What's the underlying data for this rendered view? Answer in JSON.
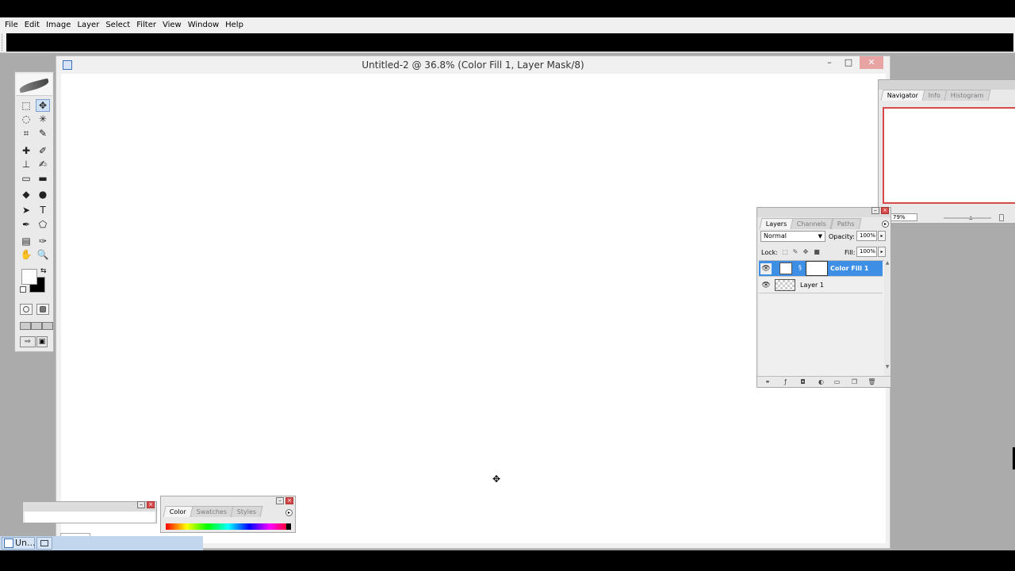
{
  "menubar": {
    "items": [
      "File",
      "Edit",
      "Image",
      "Layer",
      "Select",
      "Filter",
      "View",
      "Window",
      "Help"
    ]
  },
  "document": {
    "title": "Untitled-2 @ 36.8% (Color Fill 1, Layer Mask/8)",
    "min_label": "–",
    "max_label": "□",
    "close_label": "✕"
  },
  "toolbox": {
    "icons": [
      "marquee-icon",
      "move-icon",
      "lasso-icon",
      "magic-wand-icon",
      "crop-icon",
      "slice-icon",
      "healing-brush-icon",
      "brush-icon",
      "clone-stamp-icon",
      "history-brush-icon",
      "eraser-icon",
      "gradient-icon",
      "blur-icon",
      "dodge-icon",
      "path-selection-icon",
      "type-icon",
      "pen-icon",
      "shape-icon",
      "notes-icon",
      "eyedropper-icon",
      "hand-icon",
      "zoom-icon"
    ],
    "glyphs": [
      "⬚",
      "✥",
      "◌",
      "✳",
      "⌗",
      "✎",
      "✚",
      "✐",
      "⊥",
      "✍",
      "▭",
      "▬",
      "◆",
      "●",
      "➤",
      "T",
      "✒",
      "⬠",
      "▤",
      "✑",
      "✋",
      "🔍"
    ],
    "swap_glyph": "⇆"
  },
  "navigator": {
    "tabs": [
      "Navigator",
      "Info",
      "Histogram"
    ],
    "active_tab": "Navigator",
    "zoom": "79%",
    "view_box_color": "#d84a4a"
  },
  "layers": {
    "tabs": [
      "Layers",
      "Channels",
      "Paths"
    ],
    "active_tab": "Layers",
    "blend_mode": "Normal",
    "opacity_label": "Opacity:",
    "opacity": "100%",
    "lock_label": "Lock:",
    "fill_label": "Fill:",
    "fill": "100%",
    "items": [
      {
        "name": "Color Fill 1",
        "selected": true
      },
      {
        "name": "Layer 1",
        "selected": false
      }
    ],
    "selection_color": "#3d8fe6"
  },
  "color_palette": {
    "tabs": [
      "Color",
      "Swatches",
      "Styles"
    ],
    "active_tab": "Color"
  },
  "taskbar": {
    "item_label": "Un..."
  }
}
